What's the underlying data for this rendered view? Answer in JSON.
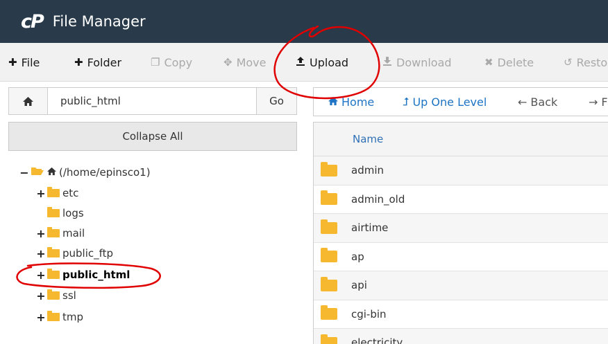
{
  "header": {
    "logo": "cP",
    "title": "File Manager"
  },
  "toolbar": {
    "file": "File",
    "folder": "Folder",
    "copy": "Copy",
    "move": "Move",
    "upload": "Upload",
    "download": "Download",
    "delete": "Delete",
    "restore": "Restore"
  },
  "path": {
    "value": "public_html",
    "go_label": "Go"
  },
  "collapse_label": "Collapse All",
  "tree": {
    "root": "(/home/epinsco1)",
    "items": [
      "etc",
      "logs",
      "mail",
      "public_ftp",
      "public_html",
      "ssl",
      "tmp"
    ]
  },
  "nav": {
    "home": "Home",
    "up": "Up One Level",
    "back": "Back",
    "forward": "Forward"
  },
  "table": {
    "header_name": "Name",
    "rows": [
      "admin",
      "admin_old",
      "airtime",
      "ap",
      "api",
      "cgi-bin",
      "electricity"
    ]
  },
  "colors": {
    "header_bg": "#293a4a",
    "folder": "#f5b82e",
    "link": "#1d74c4",
    "annotation": "#e00000"
  },
  "icons": {
    "home": "home-icon",
    "folder": "folder-icon",
    "upload": "upload-icon"
  }
}
